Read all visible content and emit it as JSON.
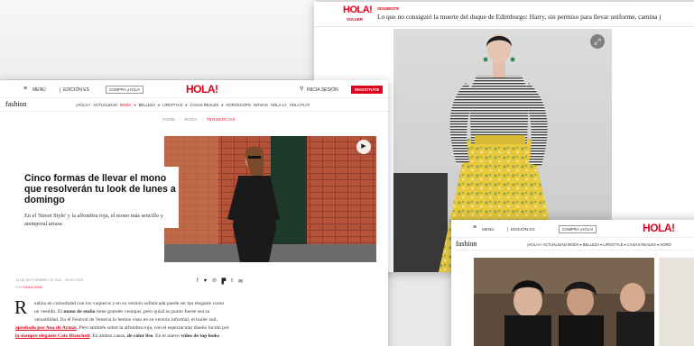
{
  "top_card": {
    "logo": "HOLA!",
    "back_label": "VOLVER",
    "next_label": "SIGUIENTE",
    "next_headline": "Lo que no consiguió la muerte del duque de Edimburgo: Harry, sin permiso para llevar uniforme, camina j"
  },
  "main_card": {
    "menu_label": "MENÚ",
    "edition_label": "EDICIÓN ES",
    "buy_label": "COMPRA ¡HOLA!",
    "logo": "HOLA!",
    "login_label": "INICIA SESIÓN",
    "register_label": "REGISTRATE",
    "section_logo": "fashion",
    "nav_items": [
      "¡HOLA!+",
      "ACTUALIDAD",
      "MODA",
      "BELLEZA",
      "LIFESTYLE",
      "CASAS REALES",
      "HORÓSCOPO",
      "NOVIAS",
      "HOLA-LA",
      "HOLA PLAY"
    ],
    "breadcrumb": [
      "HOME",
      "MODA",
      "TENDENCIAS"
    ],
    "headline": "Cinco formas de llevar el mono que resolverán tu look de lunes a domingo",
    "subheadline": "En el 'Street Style' y la alfombra roja, el mono más sencillo y atemporal arrasa",
    "date": "13 DE SEPTIEMBRE DE 2021 - 09:00 CEST",
    "author_prefix": "POR",
    "author": "HOLA.COM",
    "share_icons": [
      "facebook-icon",
      "twitter-icon",
      "pinterest-icon",
      "flipboard-icon",
      "tumblr-icon",
      "email-icon"
    ],
    "dropcap": "R",
    "para_line1": "ealiza en comodidad con los vaqueros y en su versión sofisticada puede ser tan elegante como",
    "para_line2a": "un vestido. El ",
    "para_bold": "mono de otoño",
    "para_line2b": " tiene grandes ventajas, pero quizá su punto fuerte sea su",
    "para_line3": "versatilidad. En el Festival de Venecia lo hemos visto en su versión informal, el boiler suit,",
    "para_link1": "aprobado por Ana de Armas",
    "para_line4": ". Pero también sobre la alfombra roja, con el espectacular diseño lucido por",
    "para_link2": "la siempre elegante Cate Blanchett",
    "para_line5a": ". En ambos casos, ",
    "para_bold2": "de color liso",
    "para_line5b": ". En el nuevo ",
    "para_bold3": "vídeo de top looks"
  },
  "bottom_card": {
    "menu_label": "MENÚ",
    "edition_label": "EDICIÓN ES",
    "buy_label": "COMPRA ¡HOLA!",
    "logo": "HOLA!",
    "section_logo": "fashion",
    "nav_text": "¡HOLA!+  ACTUALIDAD  MODA ▾  BELLEZA ▾  LIFESTYLE ▾  CASAS REALES ▾  HORÓ"
  },
  "colors": {
    "brand_red": "#e3001b"
  }
}
